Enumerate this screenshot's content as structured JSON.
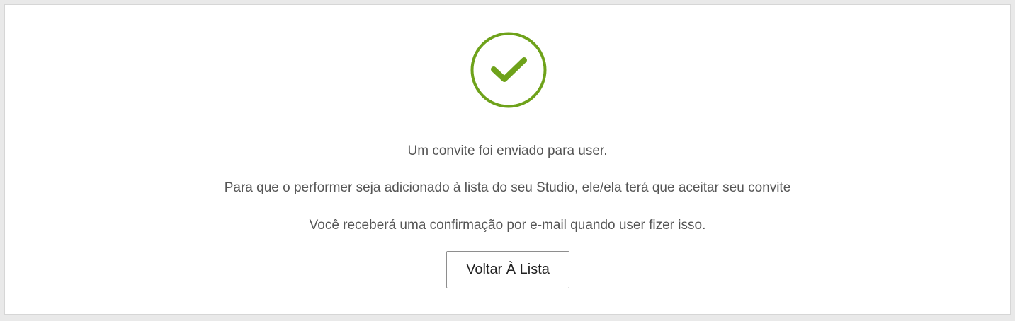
{
  "icon": {
    "name": "checkmark-circle-icon",
    "color": "#6ea21a"
  },
  "messages": {
    "invite_sent": "Um convite foi enviado para user.",
    "accept_required": "Para que o performer seja adicionado à lista do seu Studio, ele/ela terá que aceitar seu convite",
    "confirmation_email": "Você receberá uma confirmação por e-mail quando user fizer isso."
  },
  "actions": {
    "back_to_list_label": "Voltar À Lista"
  }
}
